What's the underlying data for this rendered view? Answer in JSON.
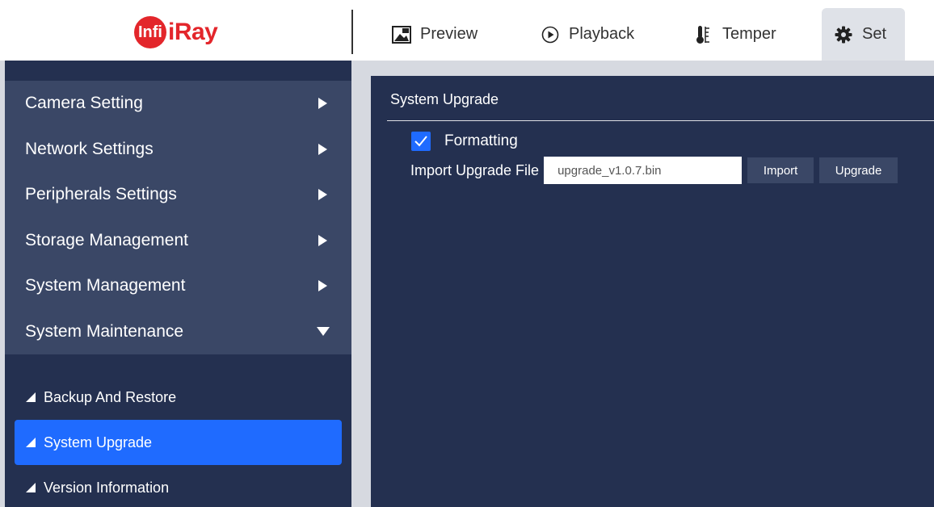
{
  "brand": {
    "logo_badge": "Infi",
    "logo_text": "iRay",
    "color": "#e3262b"
  },
  "tabs": [
    {
      "label": "Preview",
      "icon": "image-icon"
    },
    {
      "label": "Playback",
      "icon": "play-circle-icon"
    },
    {
      "label": "Temper",
      "icon": "thermometer-icon"
    },
    {
      "label": "Set",
      "icon": "gear-icon",
      "active": true
    }
  ],
  "sidebar": {
    "items": [
      {
        "label": "Camera Setting",
        "expanded": false
      },
      {
        "label": "Network Settings",
        "expanded": false
      },
      {
        "label": "Peripherals Settings",
        "expanded": false
      },
      {
        "label": "Storage Management",
        "expanded": false
      },
      {
        "label": "System Management",
        "expanded": false
      },
      {
        "label": "System Maintenance",
        "expanded": true
      }
    ],
    "subitems": [
      {
        "label": "Backup And Restore",
        "active": false
      },
      {
        "label": "System Upgrade",
        "active": true
      },
      {
        "label": "Version Information",
        "active": false
      }
    ]
  },
  "main": {
    "title": "System Upgrade",
    "formatting": {
      "label": "Formatting",
      "checked": true
    },
    "upgrade_file": {
      "label": "Import Upgrade File",
      "value": "upgrade_v1.0.7.bin",
      "import_label": "Import",
      "upgrade_label": "Upgrade"
    }
  },
  "colors": {
    "accent": "#1f6bff",
    "panel": "#243050",
    "menu": "#3a4766"
  }
}
